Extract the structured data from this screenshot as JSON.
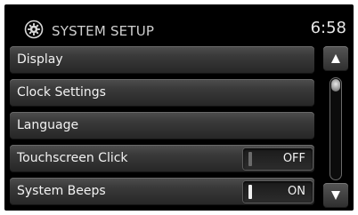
{
  "header": {
    "title": "SYSTEM SETUP",
    "time": "6:58",
    "icon": "settings-gear-icon"
  },
  "menu": {
    "items": [
      {
        "label": "Display"
      },
      {
        "label": "Clock Settings"
      },
      {
        "label": "Language"
      },
      {
        "label": "Touchscreen Click",
        "toggle": "OFF"
      },
      {
        "label": "System Beeps",
        "toggle": "ON"
      }
    ]
  },
  "scrollbar": {
    "up_icon": "arrow-up-icon",
    "down_icon": "arrow-down-icon",
    "position": 0
  }
}
